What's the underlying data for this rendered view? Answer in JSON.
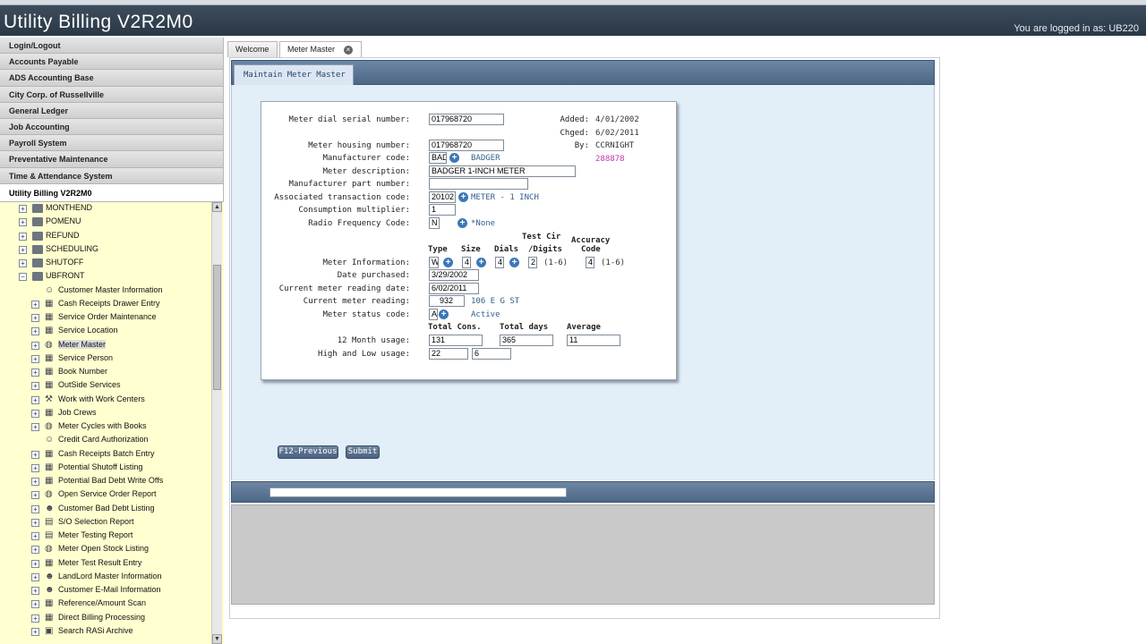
{
  "app": {
    "title": "Utility Billing V2R2M0",
    "login_text": "You are logged in as: UB220"
  },
  "sidebar": {
    "menu": [
      {
        "label": "Login/Logout"
      },
      {
        "label": "Accounts Payable"
      },
      {
        "label": "ADS Accounting Base"
      },
      {
        "label": "City Corp. of Russellville"
      },
      {
        "label": "General Ledger"
      },
      {
        "label": "Job Accounting"
      },
      {
        "label": "Payroll System"
      },
      {
        "label": "Preventative Maintenance"
      },
      {
        "label": "Time & Attendance System"
      },
      {
        "label": "Utility Billing V2R2M0"
      }
    ],
    "tree": [
      {
        "label": "MONTHEND",
        "expander": "+",
        "icon": "folder"
      },
      {
        "label": "POMENU",
        "expander": "+",
        "icon": "folder"
      },
      {
        "label": "REFUND",
        "expander": "+",
        "icon": "folder"
      },
      {
        "label": "SCHEDULING",
        "expander": "+",
        "icon": "folder"
      },
      {
        "label": "SHUTOFF",
        "expander": "+",
        "icon": "folder"
      },
      {
        "label": "UBFRONT",
        "expander": "−",
        "icon": "folder"
      },
      {
        "label": "Customer Master Information",
        "expander": "",
        "icon": "person"
      },
      {
        "label": "Cash Receipts Drawer Entry",
        "expander": "+",
        "icon": "grid"
      },
      {
        "label": "Service Order Maintenance",
        "expander": "+",
        "icon": "grid"
      },
      {
        "label": "Service Location",
        "expander": "+",
        "icon": "grid"
      },
      {
        "label": "Meter Master",
        "expander": "+",
        "icon": "gauge"
      },
      {
        "label": "Service Person",
        "expander": "+",
        "icon": "grid"
      },
      {
        "label": "Book Number",
        "expander": "+",
        "icon": "grid"
      },
      {
        "label": "OutSide Services",
        "expander": "+",
        "icon": "grid"
      },
      {
        "label": "Work with Work Centers",
        "expander": "+",
        "icon": "tool"
      },
      {
        "label": "Job Crews",
        "expander": "+",
        "icon": "grid"
      },
      {
        "label": "Meter Cycles with Books",
        "expander": "+",
        "icon": "gauge"
      },
      {
        "label": "Credit Card Authorization",
        "expander": "",
        "icon": "person"
      },
      {
        "label": "Cash Receipts Batch Entry",
        "expander": "+",
        "icon": "grid"
      },
      {
        "label": "Potential Shutoff Listing",
        "expander": "+",
        "icon": "grid"
      },
      {
        "label": "Potential Bad Debt Write Offs",
        "expander": "+",
        "icon": "grid"
      },
      {
        "label": "Open Service Order Report",
        "expander": "+",
        "icon": "gauge"
      },
      {
        "label": "Customer Bad Debt Listing",
        "expander": "+",
        "icon": "people"
      },
      {
        "label": "S/O Selection Report",
        "expander": "+",
        "icon": "doc"
      },
      {
        "label": "Meter Testing Report",
        "expander": "+",
        "icon": "doc"
      },
      {
        "label": "Meter Open Stock Listing",
        "expander": "+",
        "icon": "gauge"
      },
      {
        "label": "Meter Test Result Entry",
        "expander": "+",
        "icon": "grid"
      },
      {
        "label": "LandLord Master Information",
        "expander": "+",
        "icon": "people"
      },
      {
        "label": "Customer E-Mail Information",
        "expander": "+",
        "icon": "people"
      },
      {
        "label": "Reference/Amount Scan",
        "expander": "+",
        "icon": "grid"
      },
      {
        "label": "Direct Billing Processing",
        "expander": "+",
        "icon": "grid"
      },
      {
        "label": "Search RASi Archive",
        "expander": "+",
        "icon": "archive"
      }
    ],
    "selected": "Meter Master"
  },
  "tabs": [
    {
      "label": "Welcome"
    },
    {
      "label": "Meter Master"
    }
  ],
  "panel": {
    "title": "Maintain Meter Master"
  },
  "form": {
    "meter_dial_serial_label": "Meter dial serial number:",
    "meter_dial_serial_value": "017968720",
    "meter_housing_label": "Meter housing number:",
    "meter_housing_value": "017968720",
    "manufacturer_code_label": "Manufacturer code:",
    "manufacturer_code_value": "BAD",
    "manufacturer_code_desc": "BADGER",
    "meter_description_label": "Meter description:",
    "meter_description_value": "BADGER 1-INCH METER",
    "manufacturer_part_label": "Manufacturer part number:",
    "manufacturer_part_value": "",
    "assoc_trans_label": "Associated transaction code:",
    "assoc_trans_value": "20102",
    "assoc_trans_desc": "METER - 1 INCH",
    "consumption_label": "Consumption multiplier:",
    "consumption_value": "1",
    "radio_freq_label": "Radio Frequency Code:",
    "radio_freq_value": "N",
    "radio_freq_desc": "*None",
    "meter_info_label": "Meter Information:",
    "col_type": "Type",
    "col_size": "Size",
    "col_dials": "Dials",
    "col_test_cir_1": "Test Cir",
    "col_test_cir_2": "/Digits",
    "col_accuracy_1": "Accuracy",
    "col_accuracy_2": "Code",
    "type_value": "W",
    "size_value": "4",
    "dials_value": "4",
    "test_cir_value": "2",
    "test_cir_range": "(1-6)",
    "accuracy_value": "4",
    "accuracy_range": "(1-6)",
    "date_purchased_label": "Date purchased:",
    "date_purchased_value": "3/29/2002",
    "current_reading_date_label": "Current meter reading date:",
    "current_reading_date_value": "6/02/2011",
    "current_reading_label": "Current meter reading:",
    "current_reading_value": "932",
    "current_reading_desc": "106 E G ST",
    "status_label": "Meter status code:",
    "status_value": "A",
    "status_desc": "Active",
    "col_total_cons": "Total Cons.",
    "col_total_days": "Total days",
    "col_average": "Average",
    "usage_12_label": "12 Month usage:",
    "usage_12_cons": "131",
    "usage_12_days": "365",
    "usage_12_avg": "11",
    "high_low_label": "High and Low usage:",
    "high_value": "22",
    "low_value": "6",
    "added_label": "Added:",
    "added_value": "4/01/2002",
    "chged_label": "Chged:",
    "chged_value": "6/02/2011",
    "by_label": "By:",
    "by_value": "CCRNIGHT",
    "record_id": "288878"
  },
  "buttons": {
    "previous": "F12-Previous",
    "submit": "Submit"
  },
  "colors": {
    "header_bg": "#2f3d4c",
    "tree_bg": "#ffffcf",
    "panel_bg": "#e2eef8",
    "accent_blue": "#34608e",
    "magenta": "#c03aa8"
  }
}
